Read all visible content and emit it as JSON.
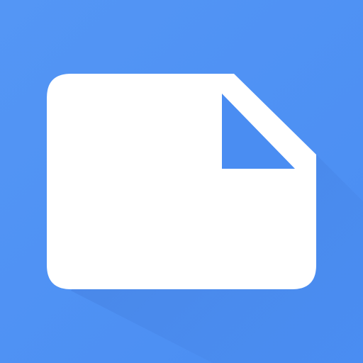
{
  "icon": {
    "name": "file-document-icon",
    "colors": {
      "background": "#4A8DF2",
      "background_light": "#5496F5",
      "shadow": "#3F77D6",
      "document": "#FFFFFF",
      "fold": "#4A8DF2"
    }
  }
}
